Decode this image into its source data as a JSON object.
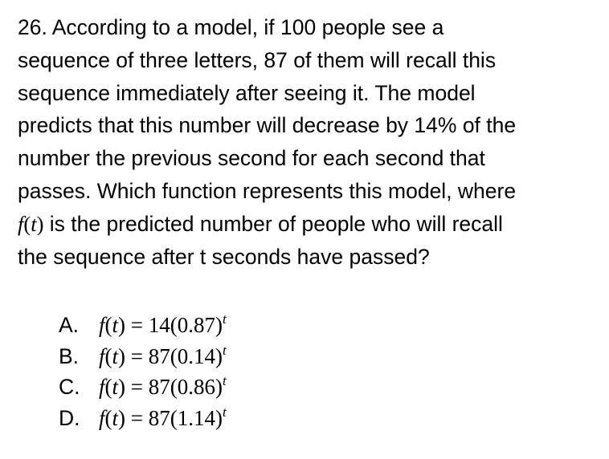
{
  "question": {
    "lines": [
      "26. According to a model, if 100 people see a",
      "sequence of three letters, 87 of them will recall this",
      "sequence immediately after seeing it. The model",
      "predicts that this number will decrease by 14% of the",
      "number the previous second for each second that",
      "passes. Which function represents this model, where"
    ],
    "line7_math": {
      "fn": "f",
      "open": "(",
      "var": "t",
      "close": ")"
    },
    "line7_rest": " is the predicted number of people who will recall",
    "line8": "the sequence after t seconds have passed?"
  },
  "choices": [
    {
      "letter": "A.",
      "fn": "f",
      "var": "t",
      "rhs": " = 14(0.87)",
      "exp": "t"
    },
    {
      "letter": "B.",
      "fn": "f",
      "var": "t",
      "rhs": " = 87(0.14)",
      "exp": "t"
    },
    {
      "letter": "C.",
      "fn": "f",
      "var": "t",
      "rhs": " = 87(0.86)",
      "exp": "t"
    },
    {
      "letter": "D.",
      "fn": "f",
      "var": "t",
      "rhs": " = 87(1.14)",
      "exp": "t"
    }
  ]
}
